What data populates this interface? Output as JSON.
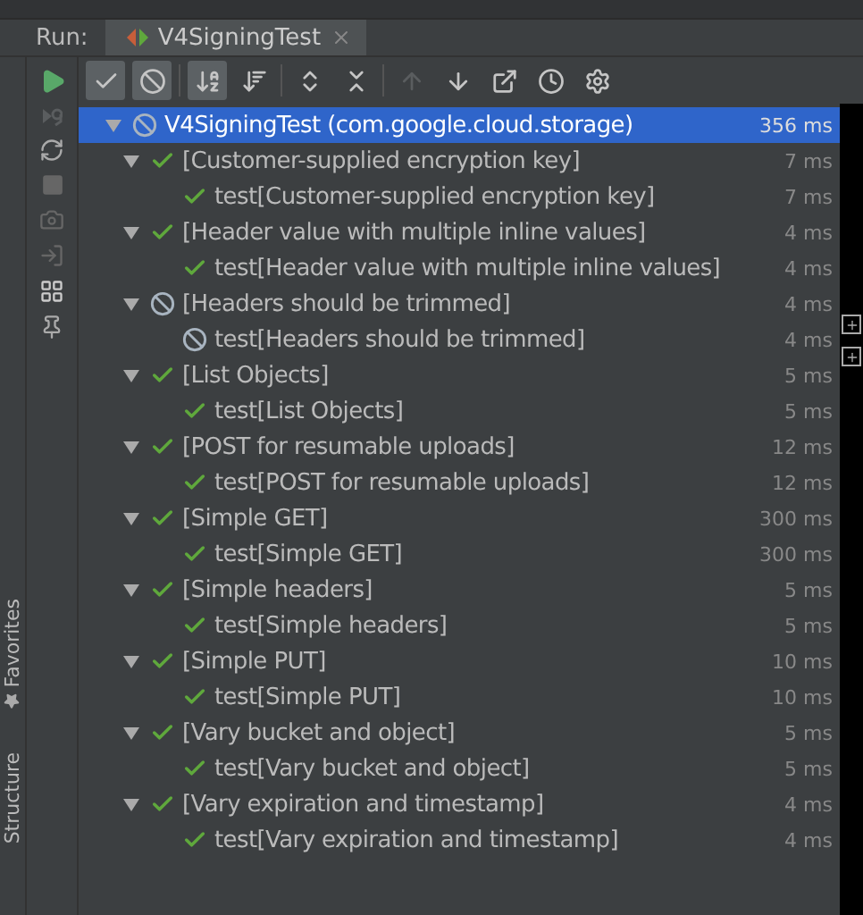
{
  "run_bar": {
    "label": "Run:",
    "tab": {
      "title": "V4SigningTest"
    }
  },
  "toolbar": [
    {
      "kind": "show-passed",
      "selected": true
    },
    {
      "kind": "show-ignored",
      "selected": true
    },
    {
      "kind": "sort-alpha",
      "selected": true
    },
    {
      "kind": "sort-duration",
      "selected": false
    },
    {
      "kind": "expand-all",
      "selected": false
    },
    {
      "kind": "collapse-all",
      "selected": false
    },
    {
      "kind": "prev",
      "selected": false,
      "disabled": true
    },
    {
      "kind": "next",
      "selected": false,
      "disabled": false
    },
    {
      "kind": "export",
      "selected": false,
      "disabled": false
    },
    {
      "kind": "history",
      "selected": false,
      "disabled": false
    },
    {
      "kind": "settings",
      "selected": false,
      "disabled": false
    }
  ],
  "side_tabs": [
    "Favorites",
    "Structure"
  ],
  "tree": {
    "name": "V4SigningTest (com.google.cloud.storage)",
    "time": "356 ms",
    "kind": "ignored",
    "selected": true,
    "expanded": true,
    "children": [
      {
        "name": "[Customer-supplied encryption key]",
        "time": "7 ms",
        "kind": "passed",
        "expanded": true,
        "children": [
          {
            "name": "test[Customer-supplied encryption key]",
            "time": "7 ms",
            "kind": "passed"
          }
        ]
      },
      {
        "name": "[Header value with multiple inline values]",
        "time": "4 ms",
        "kind": "passed",
        "expanded": true,
        "children": [
          {
            "name": "test[Header value with multiple inline values]",
            "time": "4 ms",
            "kind": "passed"
          }
        ]
      },
      {
        "name": "[Headers should be trimmed]",
        "time": "4 ms",
        "kind": "ignored",
        "expanded": true,
        "children": [
          {
            "name": "test[Headers should be trimmed]",
            "time": "4 ms",
            "kind": "ignored"
          }
        ]
      },
      {
        "name": "[List Objects]",
        "time": "5 ms",
        "kind": "passed",
        "expanded": true,
        "children": [
          {
            "name": "test[List Objects]",
            "time": "5 ms",
            "kind": "passed"
          }
        ]
      },
      {
        "name": "[POST for resumable uploads]",
        "time": "12 ms",
        "kind": "passed",
        "expanded": true,
        "children": [
          {
            "name": "test[POST for resumable uploads]",
            "time": "12 ms",
            "kind": "passed"
          }
        ]
      },
      {
        "name": "[Simple GET]",
        "time": "300 ms",
        "kind": "passed",
        "expanded": true,
        "children": [
          {
            "name": "test[Simple GET]",
            "time": "300 ms",
            "kind": "passed"
          }
        ]
      },
      {
        "name": "[Simple headers]",
        "time": "5 ms",
        "kind": "passed",
        "expanded": true,
        "children": [
          {
            "name": "test[Simple headers]",
            "time": "5 ms",
            "kind": "passed"
          }
        ]
      },
      {
        "name": "[Simple PUT]",
        "time": "10 ms",
        "kind": "passed",
        "expanded": true,
        "children": [
          {
            "name": "test[Simple PUT]",
            "time": "10 ms",
            "kind": "passed"
          }
        ]
      },
      {
        "name": "[Vary bucket and object]",
        "time": "5 ms",
        "kind": "passed",
        "expanded": true,
        "children": [
          {
            "name": "test[Vary bucket and object]",
            "time": "5 ms",
            "kind": "passed"
          }
        ]
      },
      {
        "name": "[Vary expiration and timestamp]",
        "time": "4 ms",
        "kind": "passed",
        "expanded": true,
        "children": [
          {
            "name": "test[Vary expiration and timestamp]",
            "time": "4 ms",
            "kind": "passed"
          }
        ]
      }
    ]
  }
}
